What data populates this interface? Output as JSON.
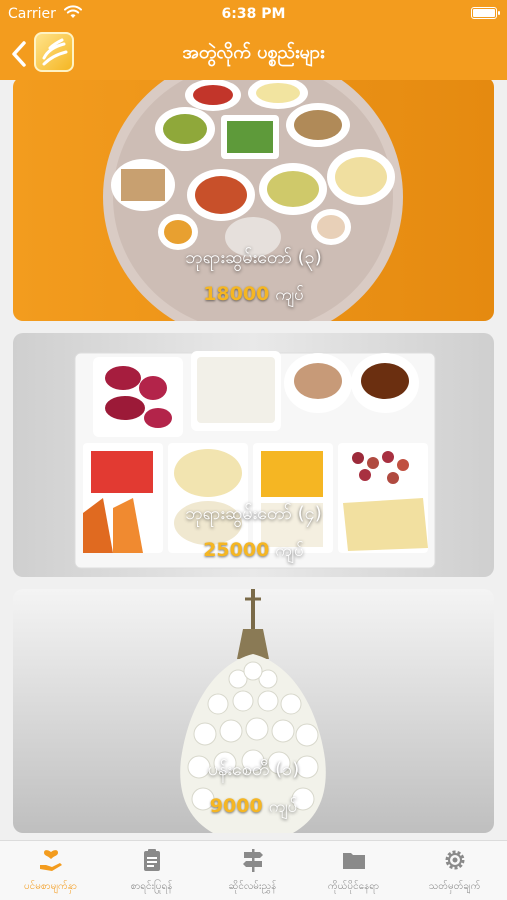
{
  "status": {
    "carrier": "Carrier",
    "time": "6:38 PM"
  },
  "nav": {
    "title": "အတွဲလိုက် ပစ္စည်းများ"
  },
  "items": [
    {
      "name": "ဘုရားဆွမ်းတော် (၃)",
      "price": "18000",
      "currency": "ကျပ်"
    },
    {
      "name": "ဘုရားဆွမ်းတော် (၄)",
      "price": "25000",
      "currency": "ကျပ်"
    },
    {
      "name": "ပန်းစေတီ (၁)",
      "price": "9000",
      "currency": "ကျပ်"
    }
  ],
  "tabs": [
    {
      "label": "ပင်မစာမျက်နှာ",
      "icon": "hand-heart-icon",
      "active": true
    },
    {
      "label": "စာရင်းပြုရန်",
      "icon": "clipboard-icon",
      "active": false
    },
    {
      "label": "ဆိုင်လမ်းညွှန်",
      "icon": "signpost-icon",
      "active": false
    },
    {
      "label": "ကိုယ်ပိုင်နေရာ",
      "icon": "folder-icon",
      "active": false
    },
    {
      "label": "သတ်မှတ်ချက်",
      "icon": "gear-icon",
      "active": false
    }
  ],
  "colors": {
    "accent": "#f39c1e",
    "price": "#f5b623",
    "inactive": "#8a8a8a"
  }
}
